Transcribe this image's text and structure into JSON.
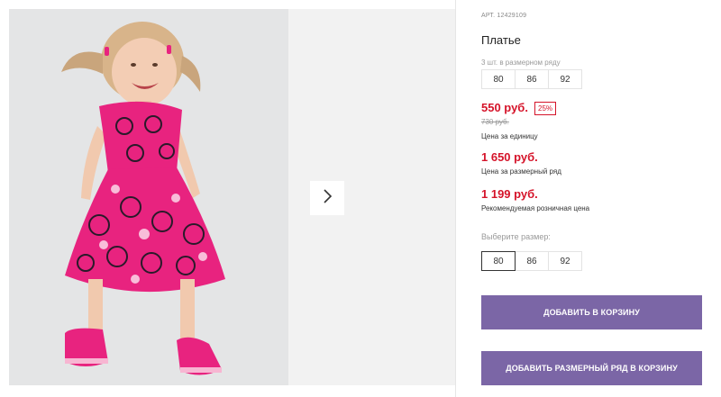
{
  "gallery": {
    "next_icon": "chevron-right-icon"
  },
  "product": {
    "article": "АРТ. 12429109",
    "title": "Платье",
    "row_note": "3 шт. в размерном ряду",
    "row_sizes": [
      "80",
      "86",
      "92"
    ],
    "price_unit": "550 руб.",
    "discount": "25%",
    "price_old": "730 руб.",
    "price_unit_label": "Цена за единицу",
    "price_row": "1 650 руб.",
    "price_row_label": "Цена за размерный ряд",
    "price_rrp": "1 199 руб.",
    "price_rrp_label": "Рекомендуемая розничная цена",
    "choose_size_label": "Выберите размер:",
    "sizes": [
      "80",
      "86",
      "92"
    ],
    "selected_size": "80"
  },
  "actions": {
    "add_to_cart": "ДОБАВИТЬ В КОРЗИНУ",
    "add_row_to_cart": "ДОБАВИТЬ РАЗМЕРНЫЙ РЯД В КОРЗИНУ"
  },
  "colors": {
    "price": "#d5142a",
    "button": "#7b66a6",
    "dress": "#e8237f"
  }
}
